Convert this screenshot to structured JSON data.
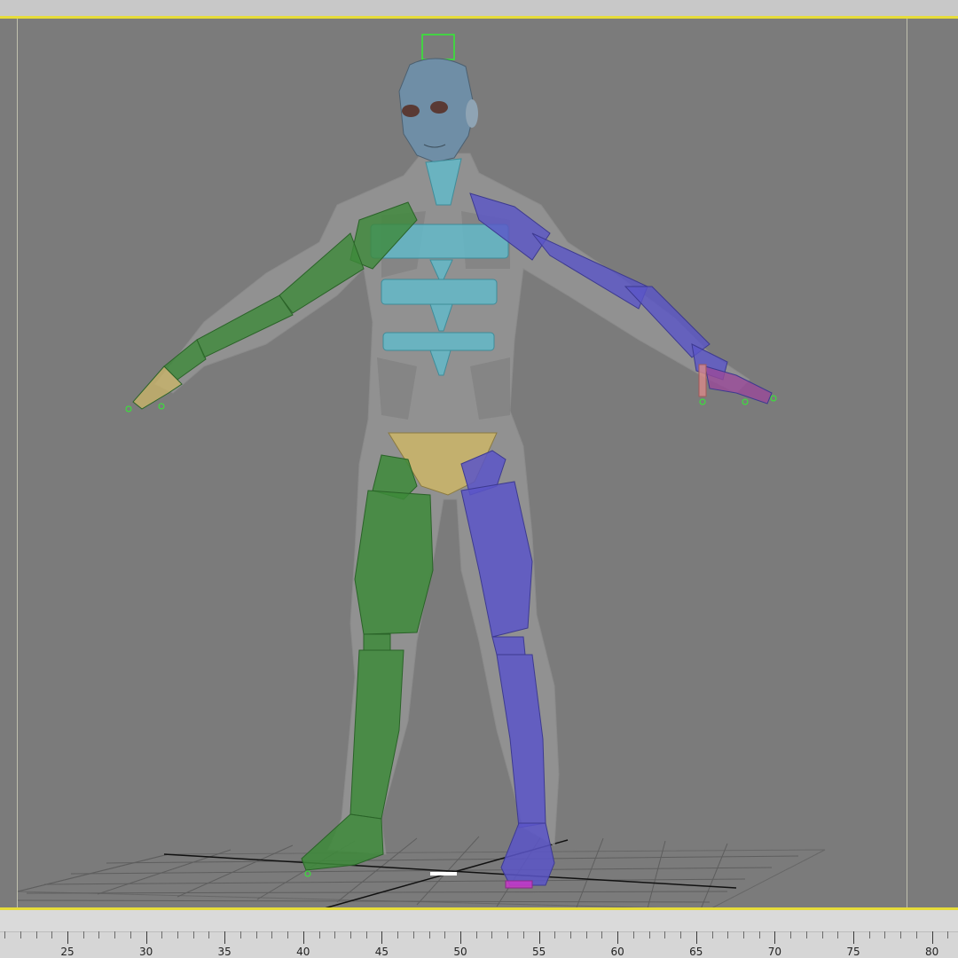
{
  "viewport": {
    "colors": {
      "background": "#7b7b7b",
      "active_border": "#e6dc3a",
      "mesh": "#a6a6a6",
      "left_limbs": "#3d8a3a",
      "right_limbs": "#5a55c8",
      "spine": "#63b9c8",
      "pelvis": "#c9b46a",
      "head": "#6f8ea6",
      "selection": "#33ee33"
    },
    "objects": [
      "character-mesh",
      "biped-skeleton",
      "ground-grid"
    ]
  },
  "timeline": {
    "frame_labels": [
      "25",
      "30",
      "35",
      "40",
      "45",
      "50",
      "55",
      "60",
      "65",
      "70",
      "75",
      "80"
    ]
  }
}
